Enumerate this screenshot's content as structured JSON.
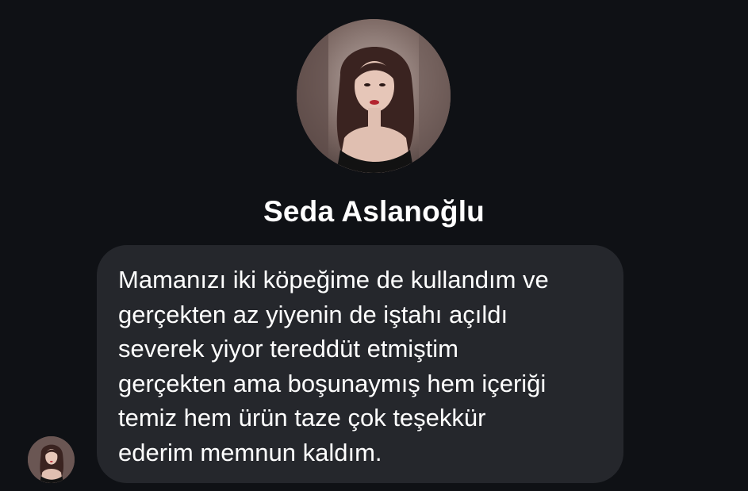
{
  "profile": {
    "name": "Seda Aslanoğlu",
    "avatar_icon": "profile-photo"
  },
  "message": {
    "lines": [
      "Mamanızı iki köpeğime de kullandım ve",
      "gerçekten az yiyenin de iştahı açıldı",
      "severek yiyor tereddüt etmiştim",
      "gerçekten ama boşunaymış hem içeriği",
      "temiz hem ürün taze çok teşekkür",
      "ederim memnun kaldım."
    ]
  },
  "colors": {
    "background": "#0f1115",
    "bubble": "#25272c",
    "text": "#ffffff"
  }
}
